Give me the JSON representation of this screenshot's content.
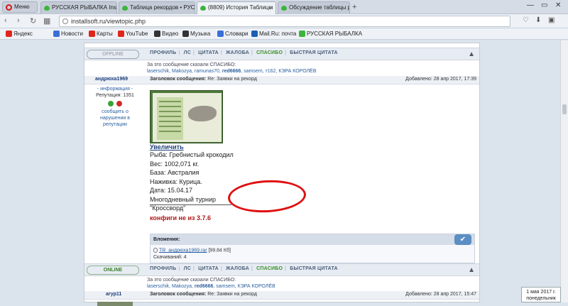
{
  "browser": {
    "menu_label": "Меню",
    "tabs": [
      {
        "label": "РУССКАЯ РЫБАЛКА Insta",
        "active": false
      },
      {
        "label": "Таблица рекордов • РУС",
        "active": false
      },
      {
        "label": "(8809) История Таблицы",
        "active": true
      },
      {
        "label": "Обсуждение таблицы ре",
        "active": false
      }
    ],
    "url": "installsoft.ru/viewtopic.php",
    "bookmarks": [
      {
        "label": "Яндекс",
        "color": "#e0261b"
      },
      {
        "label": "Новости",
        "color": "#3a6fd8"
      },
      {
        "label": "Карты",
        "color": "#e0261b"
      },
      {
        "label": "YouTube",
        "color": "#e0261b"
      },
      {
        "label": "Видео",
        "color": "#333333"
      },
      {
        "label": "Музыка",
        "color": "#333333"
      },
      {
        "label": "Словари",
        "color": "#3a6fd8"
      },
      {
        "label": "Mail.Ru: почта",
        "color": "#1a5fb4"
      },
      {
        "label": "РУССКАЯ РЫБАЛКА",
        "color": "#3cb43c"
      }
    ]
  },
  "post_bar_1": {
    "status": "OFFLINE",
    "buttons": [
      "ПРОФИЛЬ",
      "ЛС",
      "ЦИТАТА",
      "ЖАЛОБА",
      "СПАСИБО",
      "БЫСТРАЯ ЦИТАТА"
    ]
  },
  "thanks_1": {
    "label": "За это сообщение сказали СПАСИБО:",
    "names": "laserschik, Makozya, ramunas70,",
    "bold_name": "red6666",
    "names_after": ", samsem, т162, КЭРА КОРОЛЁВ"
  },
  "post": {
    "author": "андрюха1969",
    "subject_label": "Заголовок сообщения:",
    "subject": "Re: Заявки на рекорд",
    "date": "Добавлено: 28 апр 2017, 17:39",
    "info": "- информация -",
    "reputation": "Репутация: 1351",
    "report": "сообщить о нарушении в репутации",
    "enlarge": "Увеличить",
    "lines": [
      "Рыба: Гребнистый крокодил",
      "Вес: 1002,071 кг.",
      "База: Австралия",
      "Наживка: Курица.",
      "Дата: 15.04.17",
      "Многодневный турнир",
      "\"Кроссворд\""
    ],
    "config_text": "конфиги не из 3.7.6",
    "attachments_label": "Вложения:",
    "file_name": "TR_андрюха1969.rar",
    "file_size": "[99.84 Кб]",
    "downloads": "Скачиваний: 4"
  },
  "post_bar_2": {
    "status": "ONLINE",
    "buttons": [
      "ПРОФИЛЬ",
      "ЛС",
      "ЦИТАТА",
      "ЖАЛОБА",
      "СПАСИБО",
      "БЫСТРАЯ ЦИТАТА"
    ]
  },
  "thanks_2": {
    "label": "За это сообщение сказали СПАСИБО:",
    "names": "laserschik, Makozya,",
    "bold_name": "red6666",
    "names_after": ", samsem, КЭРА КОРОЛЁВ"
  },
  "post2": {
    "author": "агур11",
    "subject_label": "Заголовок сообщения:",
    "subject": "Re: Заявки на рекорд",
    "date": "Добавлено: 28 апр 2017, 15:47"
  },
  "clock": {
    "date": "1 мая 2017 г.",
    "day": "понедельник"
  }
}
